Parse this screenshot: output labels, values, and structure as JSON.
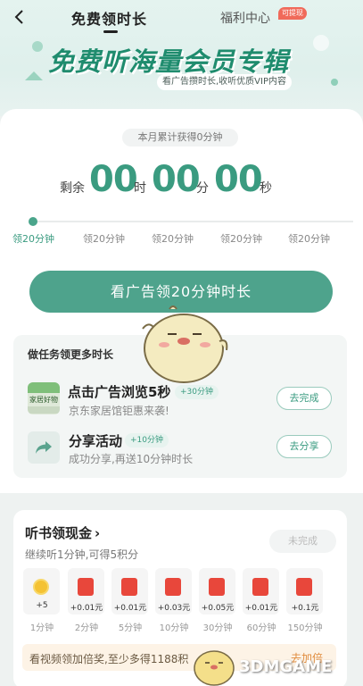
{
  "header": {
    "tab_free": "免费领时长",
    "tab_welfare": "福利中心",
    "cash_badge": "可提现"
  },
  "banner": {
    "title": "免费听海量会员专辑",
    "subtitle": "看广告攒时长,收听优质VIP内容"
  },
  "countdown": {
    "month_summary": "本月累计获得0分钟",
    "prefix": "剩余",
    "hours": "00",
    "hours_unit": "时",
    "minutes": "00",
    "minutes_unit": "分",
    "seconds": "00",
    "seconds_unit": "秒"
  },
  "timeline": [
    "领20分钟",
    "领20分钟",
    "领20分钟",
    "领20分钟",
    "领20分钟"
  ],
  "watch_button": "看广告领20分钟时长",
  "tasks": {
    "heading": "做任务领更多时长",
    "items": [
      {
        "title": "点击广告浏览5秒",
        "bonus": "+30分钟",
        "subtitle": "京东家居馆钜惠来袭!",
        "button": "去完成",
        "thumb_text": "家居好物"
      },
      {
        "title": "分享活动",
        "bonus": "+10分钟",
        "subtitle": "成功分享,再送10分钟时长",
        "button": "去分享"
      }
    ]
  },
  "listen_reward": {
    "title": "听书领现金",
    "chevron": "›",
    "subtitle": "继续听1分钟,可得5积分",
    "button": "未完成",
    "rewards": [
      {
        "amount": "+5",
        "label": "1分钟",
        "icon": "coin-icon"
      },
      {
        "amount": "+0.01元",
        "label": "2分钟",
        "icon": "red-envelope-icon"
      },
      {
        "amount": "+0.01元",
        "label": "5分钟",
        "icon": "red-envelope-icon"
      },
      {
        "amount": "+0.03元",
        "label": "10分钟",
        "icon": "red-envelope-icon"
      },
      {
        "amount": "+0.05元",
        "label": "30分钟",
        "icon": "red-envelope-icon"
      },
      {
        "amount": "+0.01元",
        "label": "60分钟",
        "icon": "red-envelope-icon"
      },
      {
        "amount": "+0.1元",
        "label": "150分钟",
        "icon": "red-envelope-icon"
      }
    ],
    "bonus_text": "看视频领加倍奖,至少多得1188积",
    "bonus_link": "去加倍"
  },
  "watermark": "3DMGAME",
  "colors": {
    "accent": "#4ea38c",
    "accent_text": "#3a9b80",
    "red_envelope": "#e8473b"
  }
}
